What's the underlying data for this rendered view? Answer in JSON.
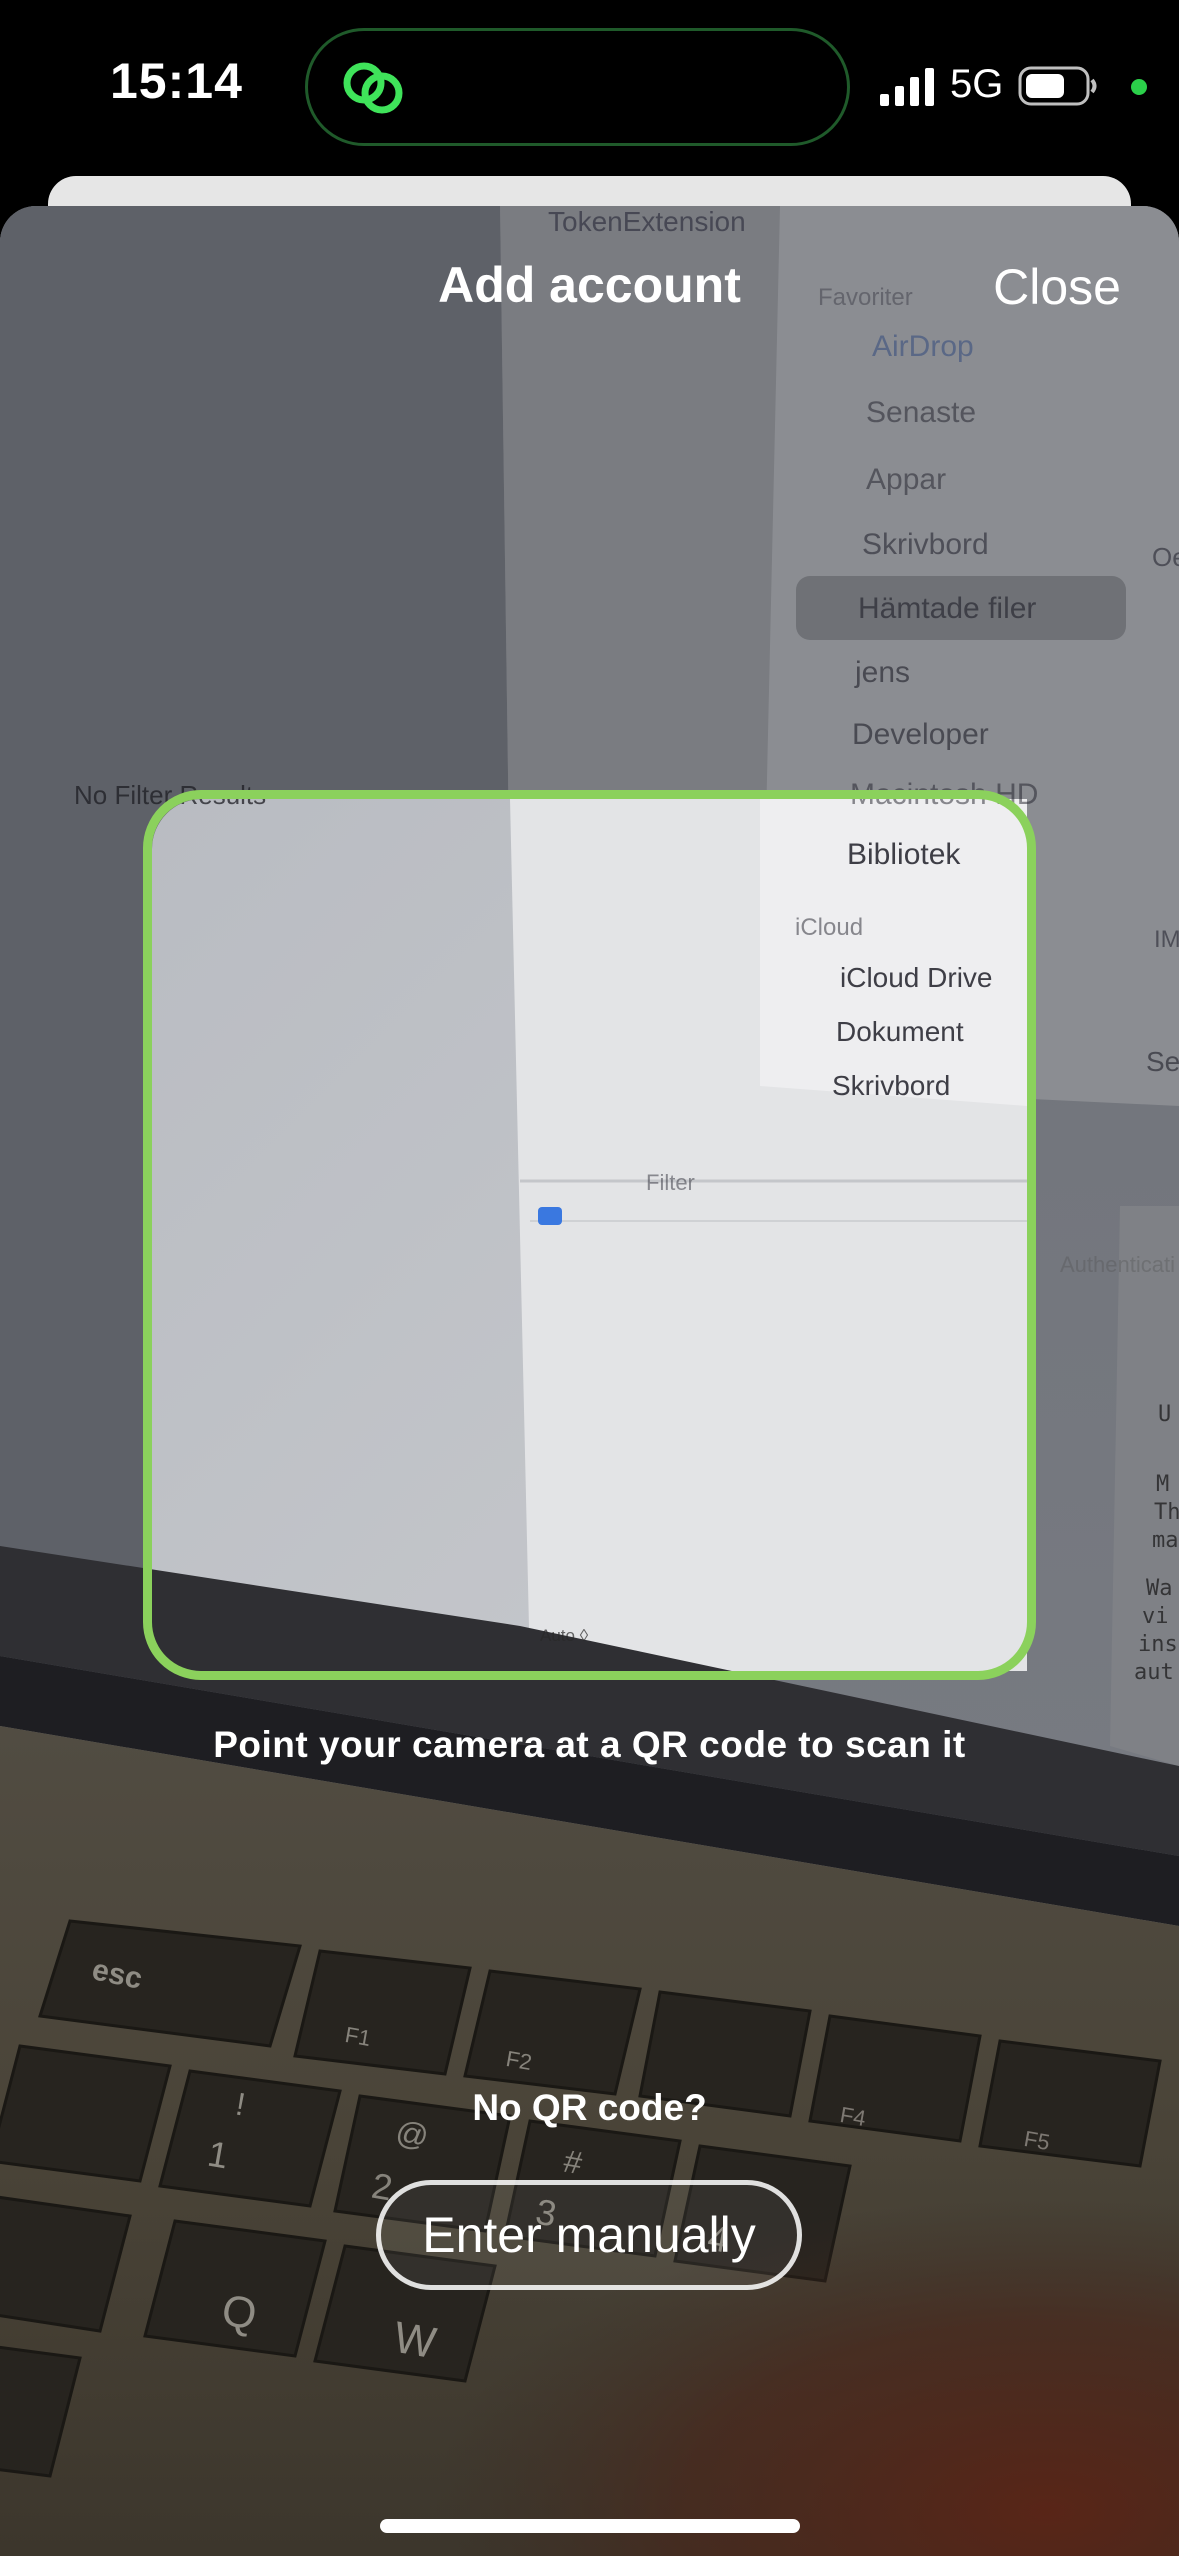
{
  "status_bar": {
    "time": "15:14",
    "network": "5G",
    "island_icon": "link-rings-icon",
    "signal_icon": "signal-bars-icon",
    "battery_icon": "battery-icon",
    "privacy_color": "#2bd04a"
  },
  "sheet": {
    "title": "Add account",
    "close_label": "Close"
  },
  "scanner": {
    "frame_color": "#8bd15c",
    "hint": "Point your camera at a QR code to scan it"
  },
  "manual_entry": {
    "question": "No QR code?",
    "button_label": "Enter manually"
  },
  "camera_view": {
    "top_crumb": "TokenExtension",
    "no_filter_results": "No Filter Results",
    "favorites_header": "Favoriter",
    "favorites": [
      "AirDrop",
      "Senaste",
      "Appar",
      "Skrivbord",
      "Hämtade filer",
      "jens",
      "Developer",
      "Macintosh HD",
      "Bibliotek"
    ],
    "icloud_header": "iCloud",
    "icloud_items": [
      "iCloud Drive",
      "Dokument",
      "Skrivbord"
    ],
    "filter_placeholder": "Filter",
    "auto_label": "Auto ◊",
    "authentication_label": "Authenticati",
    "side_labels": [
      "Oe",
      "IM",
      "Se"
    ],
    "code_fragments": [
      "U",
      "M",
      "Th",
      "ma",
      "Wa",
      "vi",
      "ins",
      "aut"
    ],
    "keys": [
      "esc",
      "F1",
      "F2",
      "F4",
      "F5",
      "!",
      "1",
      "@",
      "2",
      "#",
      "3",
      "4",
      "Q",
      "W"
    ]
  }
}
